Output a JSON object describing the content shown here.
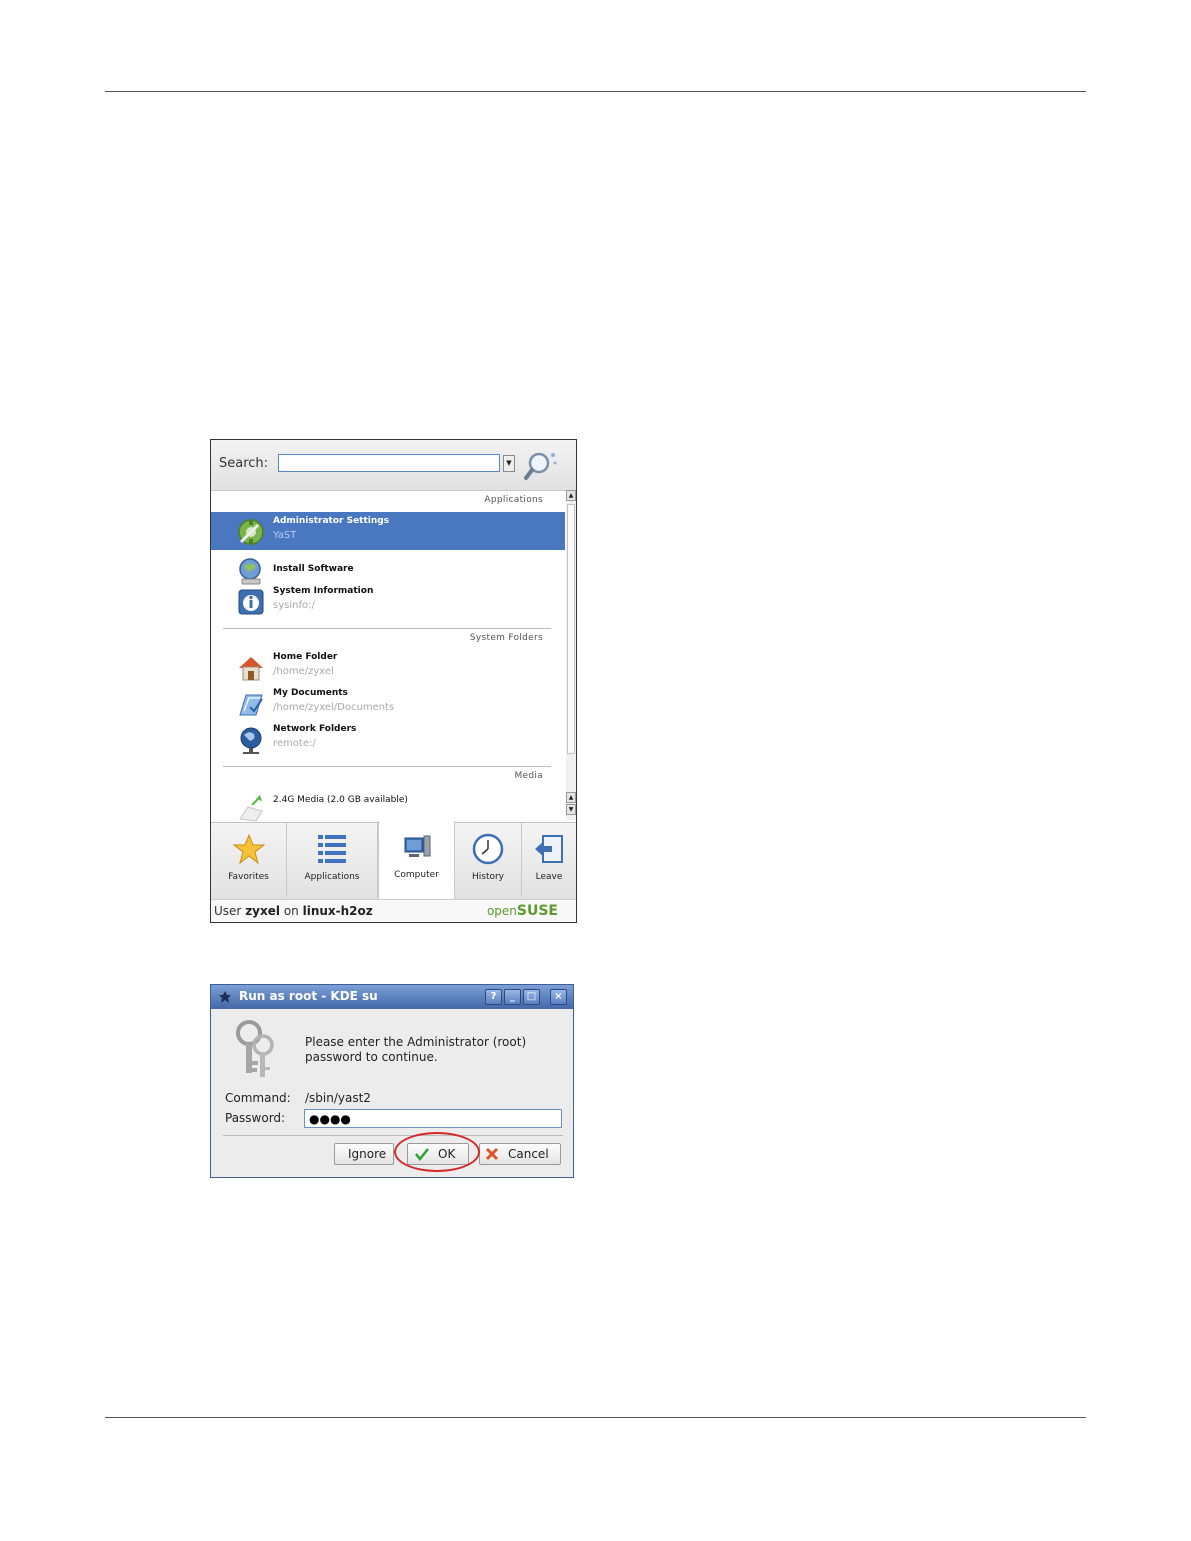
{
  "menu": {
    "search_label": "Search:",
    "search_value": "",
    "sections": {
      "applications": "Applications",
      "system_folders": "System Folders",
      "media": "Media"
    },
    "items": [
      {
        "title": "Administrator Settings",
        "subtitle": "YaST"
      },
      {
        "title": "Install Software",
        "subtitle": ""
      },
      {
        "title": "System Information",
        "subtitle": "sysinfo:/"
      },
      {
        "title": "Home Folder",
        "subtitle": "/home/zyxel"
      },
      {
        "title": "My Documents",
        "subtitle": "/home/zyxel/Documents"
      },
      {
        "title": "Network Folders",
        "subtitle": "remote:/"
      },
      {
        "title": "2.4G Media (2.0 GB available)",
        "subtitle": ""
      }
    ],
    "tabs": [
      {
        "label": "Favorites",
        "icon": "star-icon"
      },
      {
        "label": "Applications",
        "icon": "list-icon"
      },
      {
        "label": "Computer",
        "icon": "computer-icon"
      },
      {
        "label": "History",
        "icon": "clock-icon"
      },
      {
        "label": "Leave",
        "icon": "exit-icon"
      }
    ],
    "active_tab": "Computer",
    "status": {
      "prefix": "User",
      "user": "zyxel",
      "middle": "on",
      "host": "linux-h2oz"
    },
    "logo": {
      "part1": "open",
      "part2": "SUSE"
    }
  },
  "dialog": {
    "title": "Run as root - KDE su",
    "message": "Please enter the Administrator (root) password to continue.",
    "command_label": "Command:",
    "command_value": "/sbin/yast2",
    "password_label": "Password:",
    "password_value": "●●●●",
    "buttons": {
      "ignore": "Ignore",
      "ok": "OK",
      "cancel": "Cancel"
    },
    "titlebar_buttons": {
      "help": "?",
      "minimize": "_",
      "maximize": "□",
      "close": "×"
    },
    "highlight_color": "#d42a2a"
  },
  "colors": {
    "selection": "#4a78c0",
    "brand": "#5b9a2c",
    "titlebar": "#4468a8"
  }
}
